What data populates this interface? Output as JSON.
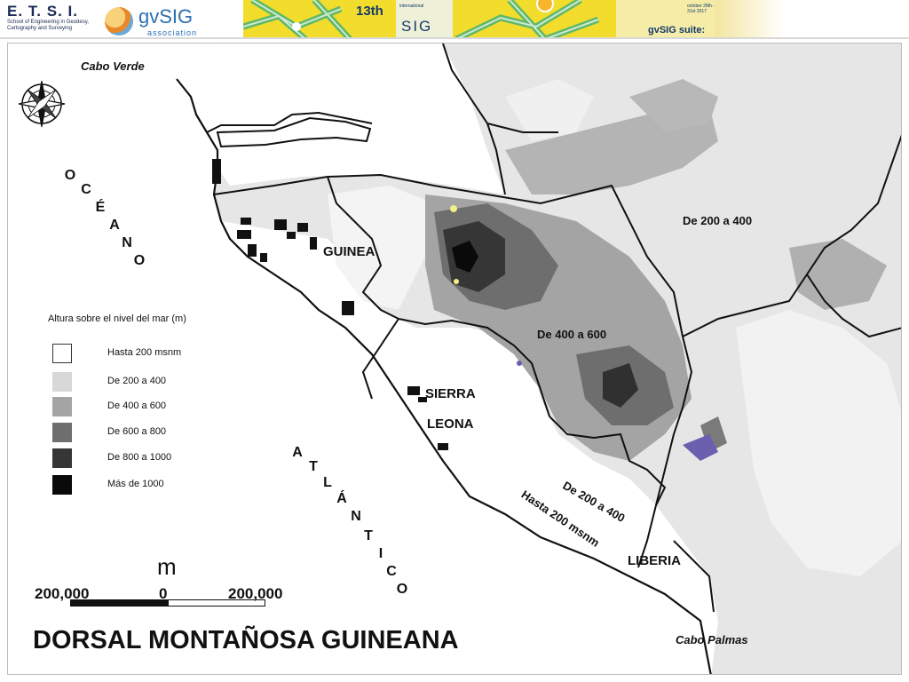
{
  "banner": {
    "etsi_title": "E. T. S. I.",
    "etsi_subtitle": "School of Engineering in Geodesy, Cartography and Surveying",
    "gvsig_name": "gvSIG",
    "gvsig_association": "association",
    "conference_number": "13th",
    "conference_international": "international",
    "conference_sig": "SIG",
    "conference_date": "october 28th - 31st 2017",
    "conference_suite": "gvSIG suite:",
    "colors": {
      "conference_bg": "#f2dc2c",
      "etsi_blue": "#1a2a55",
      "gvsig_blue": "#2a6fb3"
    }
  },
  "map": {
    "title": "DORSAL MONTAÑOSA GUINEANA",
    "compass": "compass-rose-icon",
    "countries": {
      "guinea": "GUINEA",
      "sierra_leone_line1": "SIERRA",
      "sierra_leone_line2": "LEONA",
      "liberia": "LIBERIA"
    },
    "capes": {
      "north": "Cabo Verde",
      "south": "Cabo Palmas"
    },
    "ocean_word1": [
      "O",
      "C",
      "É",
      "A",
      "N",
      "O"
    ],
    "ocean_word2": [
      "A",
      "T",
      "L",
      "Á",
      "N",
      "T",
      "I",
      "C",
      "O"
    ],
    "zone_labels": {
      "upper_right": "De 200 a 400",
      "center": "De 400 a 600",
      "lower_center": "De 200 a 400",
      "coast": "Hasta 200 msnm"
    },
    "legend": {
      "title": "Altura sobre el nivel del mar (m)",
      "items": [
        {
          "label": "Hasta 200 msnm",
          "color": "#ffffff"
        },
        {
          "label": "De 200 a 400",
          "color": "#d8d8d8"
        },
        {
          "label": "De 400 a 600",
          "color": "#a4a4a4"
        },
        {
          "label": "De 600 a 800",
          "color": "#6e6e6e"
        },
        {
          "label": "De 800 a 1000",
          "color": "#363636"
        },
        {
          "label": "Más de 1000",
          "color": "#0a0a0a"
        }
      ]
    },
    "scale": {
      "unit": "m",
      "left_value": "200,000",
      "zero": "0",
      "right_value": "200,000"
    }
  }
}
